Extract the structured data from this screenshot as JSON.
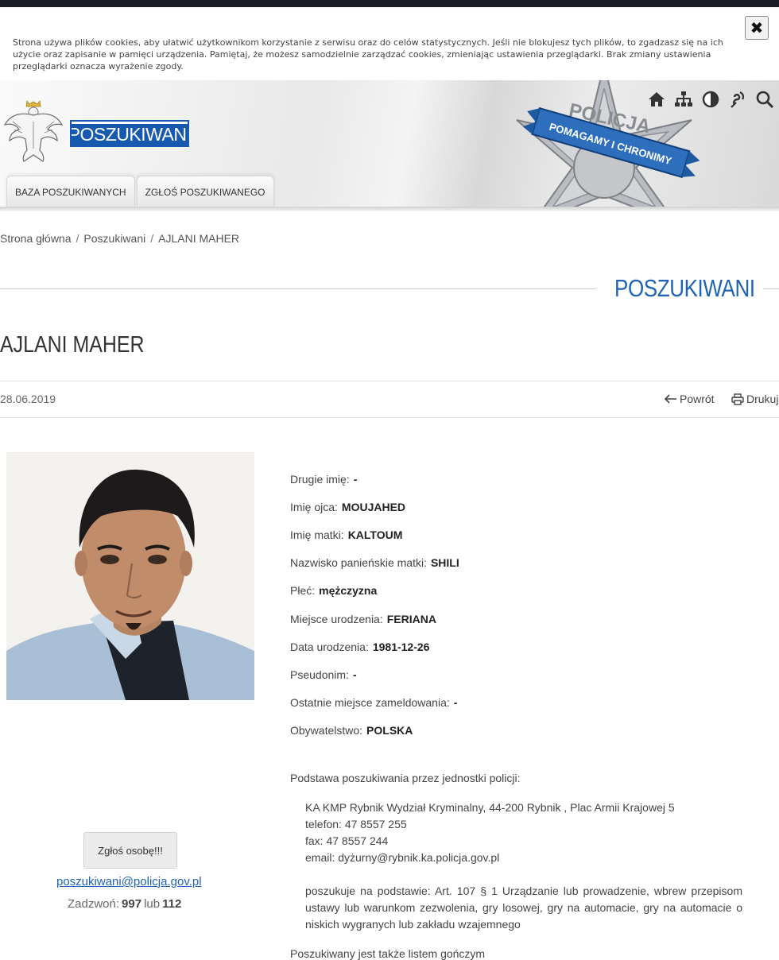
{
  "cookie": {
    "text": "Strona używa plików cookies, aby ułatwić użytkownikom korzystanie z serwisu oraz do celów statystycznych. Jeśli nie blokujesz tych plików, to zgadzasz się na ich użycie oraz zapisanie w pamięci urządzenia. Pamiętaj, że możesz samodzielnie zarządzać cookies, zmieniając ustawienia przeglądarki. Brak zmiany ustawienia przeglądarki oznacza wyrażenie zgody.",
    "close_label": "✖"
  },
  "header": {
    "logo_text": "POSZUKIWANI",
    "badge_top": "POLICJA",
    "badge_banner": "POMAGAMY I CHRONIMY",
    "tools": [
      "home-icon",
      "sitemap-icon",
      "contrast-icon",
      "accessibility-icon",
      "search-icon"
    ],
    "tabs": [
      "BAZA POSZUKIWANYCH",
      "ZGŁOŚ POSZUKIWANEGO"
    ]
  },
  "breadcrumb": [
    "Strona główna",
    "Poszukiwani",
    "AJLANI MAHER"
  ],
  "section_title": "POSZUKIWANI",
  "page_title": "AJLANI MAHER",
  "meta": {
    "date": "28.06.2019",
    "back_label": "Powrót",
    "print_label": "Drukuj"
  },
  "fields": [
    {
      "label": "Drugie imię:",
      "value": "-"
    },
    {
      "label": "Imię ojca:",
      "value": "MOUJAHED"
    },
    {
      "label": "Imię matki:",
      "value": "KALTOUM"
    },
    {
      "label": "Nazwisko panieńskie matki:",
      "value": "SHILI"
    },
    {
      "label": "Płeć:",
      "value": "mężczyzna"
    },
    {
      "label": "Miejsce urodzenia:",
      "value": "FERIANA"
    },
    {
      "label": "Data urodzenia:",
      "value": "1981-12-26"
    },
    {
      "label": "Pseudonim:",
      "value": "-"
    },
    {
      "label": "Ostatnie miejsce zameldowania:",
      "value": "-"
    },
    {
      "label": "Obywatelstwo:",
      "value": "POLSKA"
    }
  ],
  "basis": {
    "heading": "Podstawa poszukiwania przez jednostki policji:",
    "unit": "KA KMP Rybnik Wydział Kryminalny, 44-200 Rybnik , Plac Armii Krajowej 5",
    "phone": "telefon: 47 8557 255",
    "fax": "fax: 47 8557 244",
    "email": "email: dyżurny@rybnik.ka.policja.gov.pl",
    "article": "poszukuje na podstawie: Art. 107 § 1 Urządzanie lub prowadzenie, wbrew przepisom ustawy lub warunkom zezwolenia, gry losowej, gry na automacie, gry na automacie o niskich wygranych lub zakładu wzajemnego",
    "cutoff": "Poszukiwany jest także listem gończym"
  },
  "sidebar": {
    "report_button": "Zgłoś osobę!!!",
    "email": "poszukiwani@policja.gov.pl",
    "call_label": "Zadzwoń:",
    "num1": "997",
    "or_label": "lub",
    "num2": "112"
  },
  "colors": {
    "accent": "#1f63b4",
    "logo_bg": "#1859b0",
    "topbar": "#1b1c25"
  }
}
